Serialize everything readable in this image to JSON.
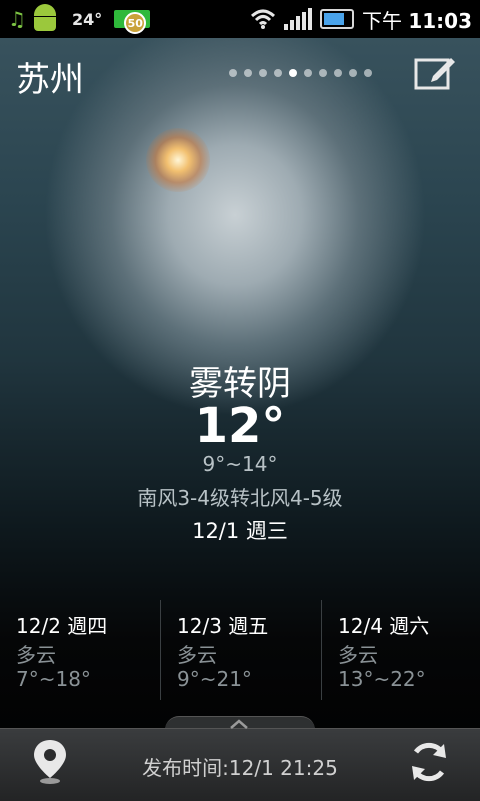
{
  "status_bar": {
    "temperature": "24°",
    "badge_count": "50",
    "time_prefix": "下午",
    "time": "11:03",
    "icons": [
      "music-note-icon",
      "android-icon",
      "notification-badge-icon",
      "wifi-icon",
      "signal-icon",
      "battery-icon"
    ]
  },
  "header": {
    "city": "苏州",
    "page_count": 10,
    "active_page": 5,
    "edit_icon": "edit-icon"
  },
  "current": {
    "condition": "雾转阴",
    "temperature": "12°",
    "range": "9°~14°",
    "wind": "南风3-4级转北风4-5级",
    "date": "12/1 週三"
  },
  "forecast": [
    {
      "date": "12/2 週四",
      "condition": "多云",
      "range": "7°~18°"
    },
    {
      "date": "12/3 週五",
      "condition": "多云",
      "range": "9°~21°"
    },
    {
      "date": "12/4 週六",
      "condition": "多云",
      "range": "13°~22°"
    }
  ],
  "bottom_bar": {
    "publish_time": "发布时间:12/1 21:25",
    "left_icon": "location-pin-icon",
    "right_icon": "refresh-icon"
  },
  "colors": {
    "accent_green": "#2fb93b",
    "battery_blue": "#4aa3ea",
    "sun": "#f2c070"
  }
}
